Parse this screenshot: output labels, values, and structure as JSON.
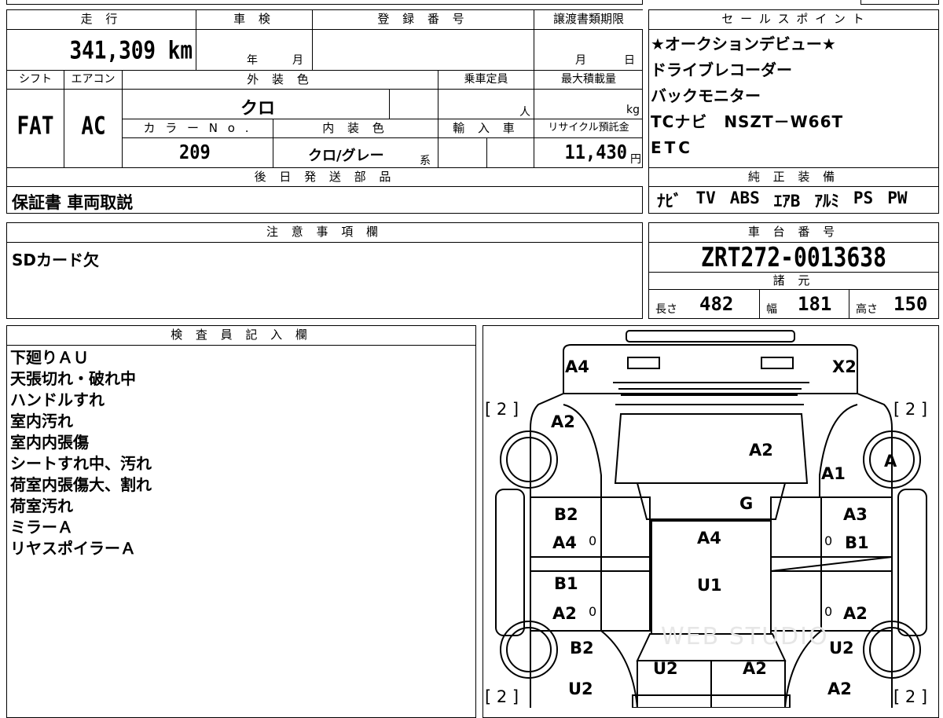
{
  "header": {
    "mileage": "走 行",
    "inspection": "車 検",
    "registration": "登 録 番 号",
    "transfer_deadline": "譲渡書類期限",
    "sales_points": "セ ー ル ス ポ イ ン ト"
  },
  "values": {
    "mileage": "341,309 km",
    "inspection_year_unit": "年",
    "inspection_month_unit": "月",
    "transfer_month_unit": "月",
    "transfer_day_unit": "日"
  },
  "labels": {
    "shift": "シフト",
    "ac": "エアコン",
    "exterior_color": "外 装 色",
    "capacity": "乗車定員",
    "max_load": "最大積載量",
    "color_no": "カ ラ ー N o .",
    "interior_color": "内 装 色",
    "import": "輸 入 車",
    "recycle": "リサイクル預託金",
    "later_parts": "後 日 発 送 部 品",
    "genuine_equipment": "純 正 装 備",
    "notes": "注 意 事 項 欄",
    "chassis_no": "車 台 番 号",
    "specs": "諸 元",
    "inspector": "検 査 員 記 入 欄",
    "length": "長さ",
    "width": "幅",
    "height": "高さ"
  },
  "vehicle": {
    "shift": "FAT",
    "ac": "AC",
    "exterior_color": "クロ",
    "capacity_unit": "人",
    "max_load_unit": "kg",
    "color_no": "209",
    "interior_color": "クロ/グレー",
    "interior_suffix": "系",
    "recycle_fee": "11,430",
    "recycle_unit": "円",
    "chassis_no": "ZRT272-0013638",
    "length": "482",
    "width": "181",
    "height": "150"
  },
  "sales_points": [
    "★オークションデビュー★",
    "ドライブレコーダー",
    "バックモニター",
    "TCナビ　NSZT－W66T",
    "ETC"
  ],
  "later_parts": "保証書 車両取説",
  "equipment": [
    "ﾅﾋﾞ",
    "TV",
    "ABS",
    "ｴｱB",
    "ｱﾙﾐ",
    "PS",
    "PW"
  ],
  "notes": "SDカード欠",
  "inspector_notes": [
    "下廻りＡＵ",
    "天張切れ・破れ中",
    "ハンドルすれ",
    "室内汚れ",
    "室内内張傷",
    "シートすれ中、汚れ",
    "荷室内張傷大、割れ",
    "荷室汚れ",
    "ミラーＡ",
    "リヤスポイラーＡ"
  ],
  "diagram": {
    "front_left": "A4",
    "front_right": "X2",
    "wheel_fl_count": "[ 2 ]",
    "wheel_fr_count": "[ 2 ]",
    "wheel_rl_count": "[ 2 ]",
    "wheel_rr_count": "[ 2 ]",
    "fender_left": "A2",
    "hood": "A2",
    "fender_right": "A1",
    "wheel_fr": "A",
    "windshield": "G",
    "front_door_left_top": "B2",
    "front_door_left_bottom": "A4",
    "front_door_right_top": "A3",
    "front_door_right_bottom": "B1",
    "roof_front": "A4",
    "roof_rear": "U1",
    "rear_door_left_top": "B1",
    "rear_door_left_bottom": "A2",
    "rear_door_right": "A2",
    "quarter_left": "B2",
    "rear_left_bottom": "U2",
    "tailgate_left": "U2",
    "tailgate_right": "A2",
    "quarter_right": "U2",
    "rear_right_bottom": "A2",
    "zero_marks": "0",
    "watermark": "WEB STUDIO"
  }
}
